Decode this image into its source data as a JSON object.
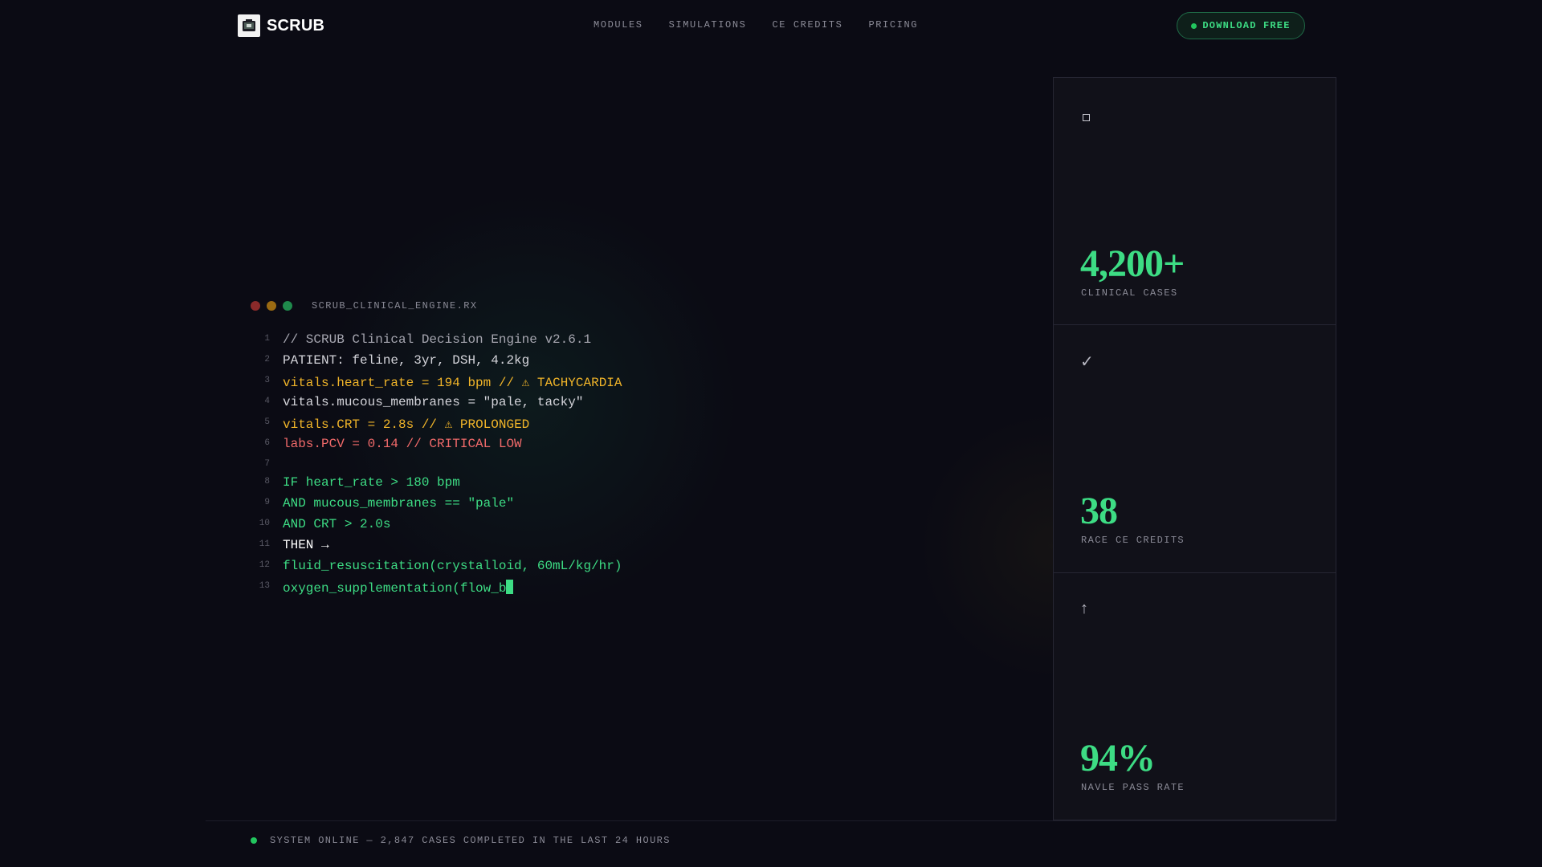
{
  "nav": {
    "logo_text": "SCRUB",
    "links": [
      "MODULES",
      "SIMULATIONS",
      "CE CREDITS",
      "PRICING"
    ],
    "download_label": "DOWNLOAD FREE"
  },
  "code_panel": {
    "title": "SCRUB_CLINICAL_ENGINE.RX",
    "lines": [
      {
        "num": "1",
        "text": "// SCRUB Clinical Decision Engine v2.6.1",
        "style": "comment"
      },
      {
        "num": "2",
        "text": "PATIENT: feline, 3yr, DSH, 4.2kg",
        "style": "plain"
      },
      {
        "num": "3",
        "text": "vitals.heart_rate = 194 bpm // ⚠ TACHYCARDIA",
        "style": "warning"
      },
      {
        "num": "4",
        "text": "vitals.mucous_membranes = \"pale, tacky\"",
        "style": "plain"
      },
      {
        "num": "5",
        "text": "vitals.CRT = 2.8s // ⚠ PROLONGED",
        "style": "warning"
      },
      {
        "num": "6",
        "text": "labs.PCV = 0.14 // CRITICAL LOW",
        "style": "critical"
      },
      {
        "num": "7",
        "text": "",
        "style": "plain"
      },
      {
        "num": "8",
        "text": "IF heart_rate > 180 bpm",
        "style": "logic"
      },
      {
        "num": "9",
        "text": "AND mucous_membranes == \"pale\"",
        "style": "logic"
      },
      {
        "num": "10",
        "text": "AND CRT > 2.0s",
        "style": "logic"
      },
      {
        "num": "11",
        "text": "THEN →",
        "style": "emphasis"
      },
      {
        "num": "12",
        "text": "fluid_resuscitation(crystalloid, 60mL/kg/hr)",
        "style": "logic"
      },
      {
        "num": "13",
        "text": "oxygen_supplementation(flow_b",
        "style": "logic"
      }
    ]
  },
  "stats": [
    {
      "icon": "square-icon",
      "value": "4,200+",
      "label": "CLINICAL CASES"
    },
    {
      "icon": "check-icon",
      "icon_glyph": "✓",
      "value": "38",
      "label": "RACE CE CREDITS"
    },
    {
      "icon": "arrow-up-icon",
      "icon_glyph": "↑",
      "value": "94%",
      "label": "NAVLE PASS RATE"
    }
  ],
  "status": {
    "text": "SYSTEM ONLINE — 2,847 CASES COMPLETED IN THE LAST 24 HOURS"
  },
  "colors": {
    "background": "#0b0b14",
    "accent_green": "#3ddc84",
    "warning": "#f0b429",
    "critical": "#f26a6a"
  }
}
